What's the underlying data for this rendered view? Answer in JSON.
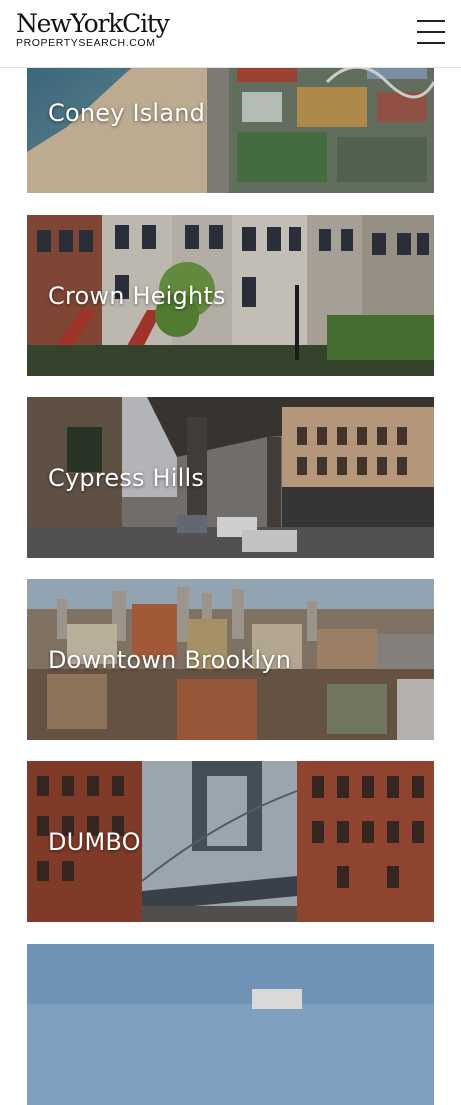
{
  "header": {
    "logo_main": "NewYorkCity",
    "logo_sub": "PROPERTYSEARCH.COM",
    "menu_icon": "hamburger-menu-icon"
  },
  "neighborhoods": [
    {
      "name": "Coney Island"
    },
    {
      "name": "Crown Heights"
    },
    {
      "name": "Cypress Hills"
    },
    {
      "name": "Downtown Brooklyn"
    },
    {
      "name": "DUMBO"
    },
    {
      "name": ""
    }
  ]
}
